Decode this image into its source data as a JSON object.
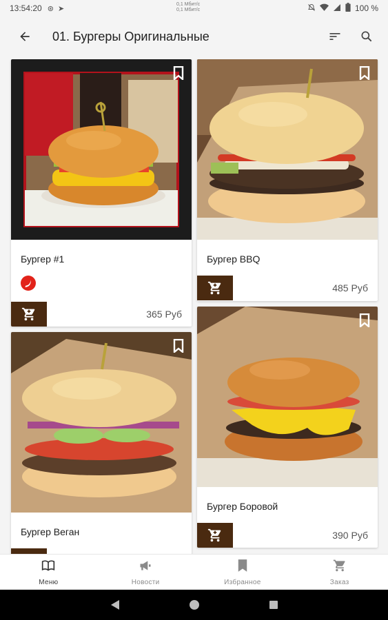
{
  "status_bar": {
    "time": "13:54:20",
    "net_line1": "0,1 Мбит/с",
    "net_line2": "0,1 Мбит/с",
    "battery": "100 %"
  },
  "app_bar": {
    "title": "01. Бургеры Оригинальные",
    "back_icon": "arrow-back-icon",
    "sort_icon": "sort-icon",
    "search_icon": "search-icon"
  },
  "products": [
    {
      "name": "Бургер #1",
      "price": "365 Руб",
      "spicy": true
    },
    {
      "name": "Бургер BBQ",
      "price": "485 Руб",
      "spicy": false
    },
    {
      "name": "Бургер Веган",
      "price": "",
      "spicy": false
    },
    {
      "name": "Бургер Боровой",
      "price": "390 Руб",
      "spicy": false
    }
  ],
  "bottom_nav": [
    {
      "label": "Меню",
      "icon": "book-icon",
      "active": true
    },
    {
      "label": "Новости",
      "icon": "megaphone-icon",
      "active": false
    },
    {
      "label": "Избранное",
      "icon": "bookmark-icon",
      "active": false
    },
    {
      "label": "Заказ",
      "icon": "cart-icon",
      "active": false
    }
  ],
  "colors": {
    "accent": "#4a2a10",
    "background": "#f4f4f4",
    "spicy_badge": "#e2231a"
  }
}
